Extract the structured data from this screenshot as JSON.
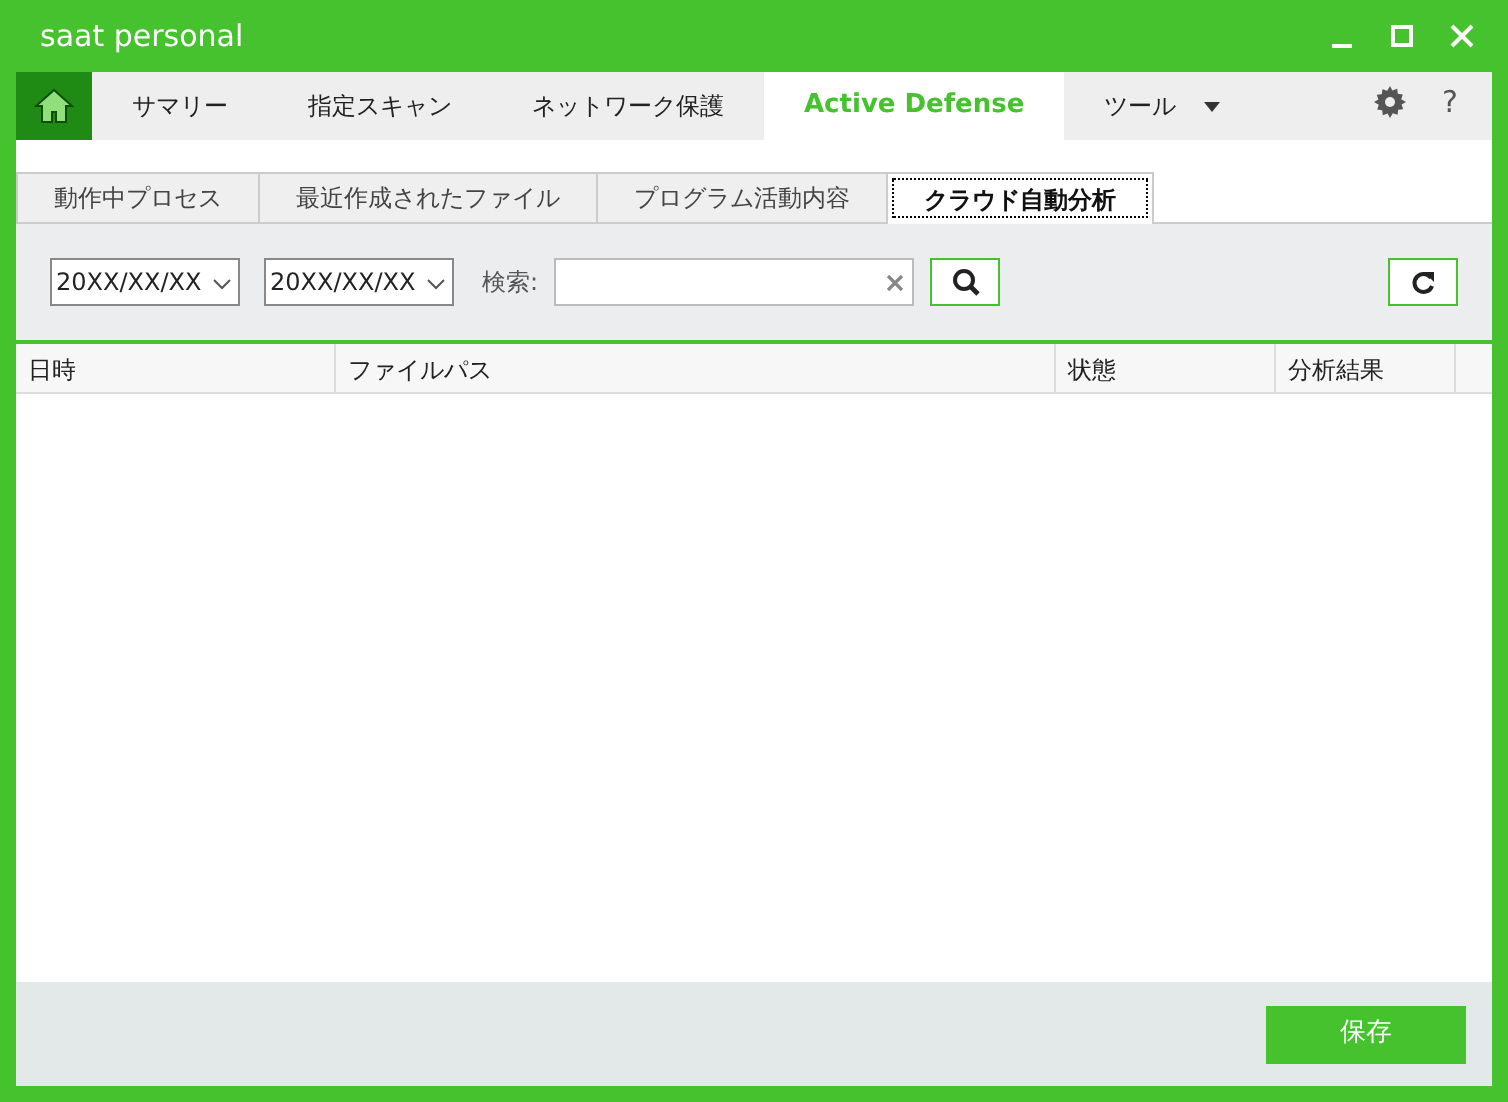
{
  "window": {
    "title": "saat personal"
  },
  "nav": [
    {
      "label": "サマリー",
      "selected": false
    },
    {
      "label": "指定スキャン",
      "selected": false
    },
    {
      "label": "ネットワーク保護",
      "selected": false
    },
    {
      "label": "Active Defense",
      "selected": true
    },
    {
      "label": "ツール",
      "selected": false,
      "dropdown": true
    }
  ],
  "help": "?",
  "subtabs": [
    {
      "label": "動作中プロセス",
      "selected": false
    },
    {
      "label": "最近作成されたファイル",
      "selected": false
    },
    {
      "label": "プログラム活動内容",
      "selected": false
    },
    {
      "label": "クラウド自動分析",
      "selected": true
    }
  ],
  "filters": {
    "date_from": "20XX/XX/XX",
    "date_to": "20XX/XX/XX",
    "search_label": "検索:"
  },
  "table": {
    "columns": [
      "日時",
      "ファイルパス",
      "状態",
      "分析結果"
    ]
  },
  "footer": {
    "save": "保存"
  }
}
